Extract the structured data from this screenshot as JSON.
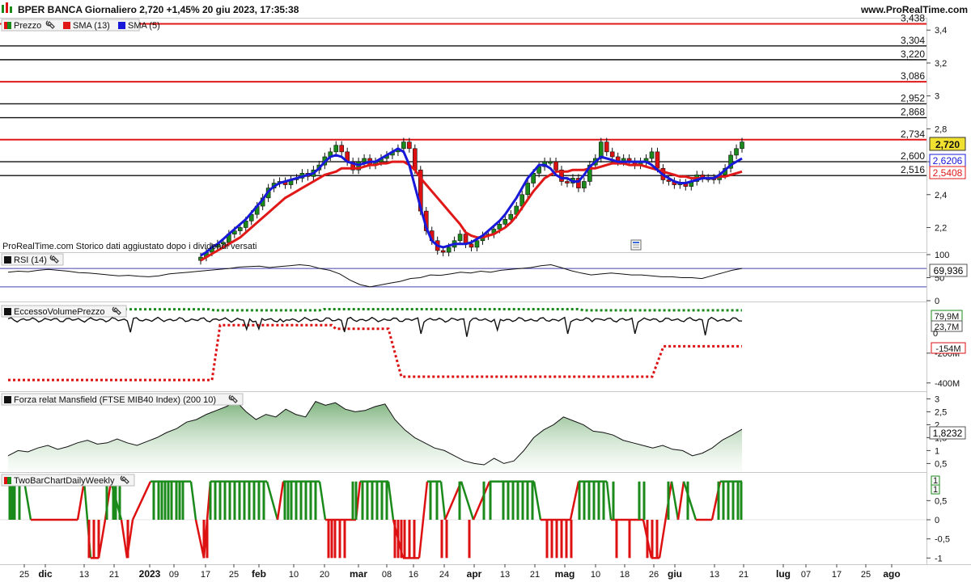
{
  "header": {
    "title": "BPER BANCA Giornaliero 2,720 +1,45% 20 giu 2023, 17:35:38",
    "site": "www.ProRealTime.com"
  },
  "price_panel": {
    "legend": {
      "price": "Prezzo",
      "sma13": "SMA (13)",
      "sma5": "SMA (5)"
    },
    "note": "ProRealTime.com  Storico dati aggiustato dopo i dividendi versati",
    "current_price": "2,720",
    "sma5_value": "2,6206",
    "sma13_value": "2,5408"
  },
  "rsi_panel": {
    "legend": "RSI (14)",
    "value": "69,936"
  },
  "volume_panel": {
    "legend": "EccessoVolumePrezzo",
    "upper_value": "79,9M",
    "mid_value": "23,7M",
    "lower_value": "-154M"
  },
  "mansfield_panel": {
    "legend": "Forza relat Mansfield (FTSE MIB40 Index) (200 10)",
    "value": "1,8232"
  },
  "twobar_panel": {
    "legend": "TwoBarChartDailyWeekly",
    "value_a": "1",
    "value_b": "1"
  },
  "colors": {
    "up": "#1a8a1a",
    "down": "#dd1111",
    "sma13": "#e01818",
    "sma5": "#1818d8",
    "accent_tag": "#f0e030"
  },
  "icons": [
    "wrench-icon",
    "news-icon"
  ],
  "chart_data": [
    {
      "type": "candlestick",
      "title": "BPER BANCA Giornaliero",
      "series": [
        {
          "name": "Prezzo",
          "values": [
            2.02,
            2.05,
            2.08,
            2.1,
            2.11,
            2.16,
            2.18,
            2.2,
            2.24,
            2.28,
            2.33,
            2.38,
            2.44,
            2.47,
            2.48,
            2.46,
            2.49,
            2.5,
            2.53,
            2.51,
            2.55,
            2.58,
            2.63,
            2.66,
            2.7,
            2.66,
            2.6,
            2.55,
            2.6,
            2.62,
            2.58,
            2.6,
            2.62,
            2.64,
            2.66,
            2.68,
            2.72,
            2.68,
            2.55,
            2.3,
            2.18,
            2.12,
            2.06,
            2.05,
            2.08,
            2.12,
            2.16,
            2.1,
            2.08,
            2.12,
            2.15,
            2.16,
            2.19,
            2.22,
            2.25,
            2.28,
            2.33,
            2.4,
            2.47,
            2.53,
            2.57,
            2.6,
            2.6,
            2.55,
            2.48,
            2.47,
            2.5,
            2.44,
            2.48,
            2.58,
            2.62,
            2.72,
            2.66,
            2.63,
            2.6,
            2.62,
            2.6,
            2.58,
            2.6,
            2.62,
            2.66,
            2.56,
            2.49,
            2.48,
            2.46,
            2.47,
            2.45,
            2.48,
            2.52,
            2.5,
            2.5,
            2.49,
            2.52,
            2.56,
            2.64,
            2.68,
            2.72
          ]
        },
        {
          "name": "SMA (13)",
          "values": [
            2.0,
            2.02,
            2.04,
            2.06,
            2.08,
            2.1,
            2.12,
            2.14,
            2.17,
            2.2,
            2.23,
            2.26,
            2.29,
            2.32,
            2.35,
            2.38,
            2.4,
            2.42,
            2.44,
            2.46,
            2.48,
            2.5,
            2.52,
            2.53,
            2.54,
            2.56,
            2.56,
            2.56,
            2.56,
            2.57,
            2.58,
            2.58,
            2.59,
            2.59,
            2.6,
            2.6,
            2.6,
            2.58,
            2.55,
            2.5,
            2.46,
            2.42,
            2.38,
            2.34,
            2.3,
            2.26,
            2.22,
            2.17,
            2.15,
            2.14,
            2.14,
            2.15,
            2.16,
            2.18,
            2.2,
            2.23,
            2.27,
            2.32,
            2.37,
            2.42,
            2.46,
            2.5,
            2.52,
            2.54,
            2.54,
            2.54,
            2.55,
            2.55,
            2.55,
            2.56,
            2.56,
            2.57,
            2.58,
            2.59,
            2.59,
            2.59,
            2.58,
            2.58,
            2.58,
            2.57,
            2.56,
            2.55,
            2.54,
            2.53,
            2.52,
            2.51,
            2.51,
            2.5,
            2.5,
            2.5,
            2.5,
            2.5,
            2.51,
            2.51,
            2.52,
            2.53,
            2.54
          ]
        },
        {
          "name": "SMA (5)",
          "values": [
            2.03,
            2.05,
            2.08,
            2.1,
            2.13,
            2.16,
            2.19,
            2.22,
            2.25,
            2.29,
            2.33,
            2.37,
            2.42,
            2.45,
            2.47,
            2.48,
            2.49,
            2.5,
            2.51,
            2.52,
            2.53,
            2.56,
            2.6,
            2.63,
            2.64,
            2.63,
            2.6,
            2.59,
            2.58,
            2.59,
            2.6,
            2.6,
            2.62,
            2.64,
            2.66,
            2.68,
            2.66,
            2.58,
            2.45,
            2.32,
            2.2,
            2.12,
            2.09,
            2.08,
            2.09,
            2.1,
            2.1,
            2.1,
            2.11,
            2.13,
            2.15,
            2.18,
            2.21,
            2.24,
            2.28,
            2.33,
            2.38,
            2.44,
            2.5,
            2.54,
            2.58,
            2.58,
            2.56,
            2.52,
            2.5,
            2.5,
            2.48,
            2.48,
            2.52,
            2.57,
            2.6,
            2.63,
            2.62,
            2.61,
            2.6,
            2.6,
            2.6,
            2.6,
            2.6,
            2.6,
            2.58,
            2.55,
            2.52,
            2.5,
            2.48,
            2.47,
            2.47,
            2.48,
            2.49,
            2.5,
            2.5,
            2.5,
            2.52,
            2.55,
            2.58,
            2.6,
            2.62
          ]
        }
      ],
      "ylim": [
        2.05,
        3.47
      ],
      "yticks": [
        "3,4",
        "3,2",
        "3",
        "2,8",
        "2,6",
        "2,4",
        "2,2"
      ],
      "yticks_values": [
        3.4,
        3.2,
        3.0,
        2.8,
        2.6,
        2.4,
        2.2
      ],
      "levels": [
        {
          "value": 3.438,
          "label": "3,438",
          "color": "red"
        },
        {
          "value": 3.304,
          "label": "3,304",
          "color": "black"
        },
        {
          "value": 3.22,
          "label": "3,220",
          "color": "black"
        },
        {
          "value": 3.086,
          "label": "3,086",
          "color": "red"
        },
        {
          "value": 2.952,
          "label": "2,952",
          "color": "black"
        },
        {
          "value": 2.868,
          "label": "2,868",
          "color": "black"
        },
        {
          "value": 2.734,
          "label": "2,734",
          "color": "red"
        },
        {
          "value": 2.6,
          "label": "2,600",
          "color": "black"
        },
        {
          "value": 2.516,
          "label": "2,516",
          "color": "black"
        }
      ]
    },
    {
      "type": "line",
      "title": "RSI (14)",
      "values": [
        62,
        64,
        63,
        66,
        68,
        66,
        64,
        61,
        60,
        58,
        56,
        54,
        55,
        53,
        52,
        54,
        58,
        60,
        62,
        64,
        66,
        68,
        70,
        73,
        74,
        75,
        72,
        74,
        76,
        78,
        76,
        70,
        66,
        58,
        45,
        35,
        30,
        34,
        38,
        42,
        48,
        50,
        56,
        55,
        58,
        62,
        60,
        64,
        62,
        66,
        68,
        70,
        72,
        76,
        78,
        72,
        65,
        60,
        56,
        58,
        60,
        58,
        56,
        56,
        54,
        52,
        52,
        50,
        50,
        48,
        54,
        60,
        66,
        70
      ],
      "ylim": [
        0,
        100
      ],
      "yticks": [
        "100",
        "50",
        "0"
      ],
      "yticks_values": [
        100,
        50,
        0
      ],
      "bands": [
        70,
        30
      ]
    },
    {
      "type": "line",
      "title": "EccessoVolumePrezzo",
      "yticks": [
        "-200M",
        "-400M"
      ],
      "yticks_values": [
        -200,
        -400
      ],
      "ylim": [
        -450,
        130
      ]
    },
    {
      "type": "area",
      "title": "Forza relat Mansfield (FTSE MIB40 Index) (200 10)",
      "values": [
        0.8,
        1.0,
        0.95,
        1.1,
        1.2,
        1.05,
        1.15,
        1.3,
        1.4,
        1.25,
        1.3,
        1.45,
        1.3,
        1.2,
        1.35,
        1.5,
        1.7,
        1.85,
        2.1,
        2.2,
        2.4,
        2.55,
        2.7,
        2.9,
        2.5,
        2.2,
        2.4,
        2.3,
        2.6,
        2.4,
        2.3,
        2.9,
        2.75,
        2.85,
        2.6,
        2.5,
        2.55,
        2.7,
        2.8,
        2.2,
        1.8,
        1.5,
        1.3,
        1.1,
        1.0,
        0.8,
        0.6,
        0.5,
        0.45,
        0.7,
        0.5,
        0.6,
        1.0,
        1.5,
        1.8,
        2.0,
        2.3,
        2.15,
        2.0,
        1.75,
        1.7,
        1.6,
        1.4,
        1.3,
        1.2,
        1.1,
        1.2,
        1.05,
        1.0,
        0.8,
        0.9,
        1.1,
        1.4,
        1.6,
        1.8232
      ],
      "ylim": [
        0.2,
        3.2
      ],
      "yticks": [
        "3",
        "2,5",
        "2",
        "1,5",
        "1",
        "0,5"
      ],
      "yticks_values": [
        3,
        2.5,
        2,
        1.5,
        1,
        0.5
      ]
    },
    {
      "type": "line",
      "title": "TwoBarChartDailyWeekly",
      "ylim": [
        -1.12,
        1.12
      ],
      "yticks": [
        "0,5",
        "0",
        "-0,5",
        "-1"
      ],
      "yticks_values": [
        0.5,
        0,
        -0.5,
        -1
      ]
    }
  ],
  "xaxis": {
    "labels": [
      "25",
      "dic",
      "13",
      "21",
      "2023",
      "09",
      "17",
      "25",
      "feb",
      "10",
      "20",
      "mar",
      "08",
      "16",
      "24",
      "apr",
      "13",
      "21",
      "mag",
      "10",
      "18",
      "26",
      "giu",
      "13",
      "21",
      "lug",
      "07",
      "17",
      "25",
      "ago"
    ]
  }
}
